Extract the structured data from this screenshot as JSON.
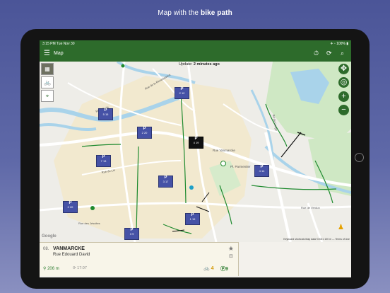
{
  "headline": {
    "prefix": "Map with the ",
    "bold": "bike path"
  },
  "status_bar": {
    "time": "3:15 PM   Tue Nov 30",
    "right": "✈ ◦ 100% ▮"
  },
  "app_bar": {
    "title": "Map",
    "menu_icon": "hamburger-icon",
    "actions": [
      "timer-icon",
      "refresh-icon",
      "search-icon"
    ]
  },
  "map": {
    "update_prefix": "Update: ",
    "update_value": "2 minutes ago",
    "layer_buttons": [
      "satellite-layer-icon",
      "bike-layer-icon",
      "location-pin-icon"
    ],
    "zoom_buttons": [
      "+",
      "◎",
      "+",
      "−"
    ],
    "street_labels": [
      "Rue de la Renaissance",
      "Rue du Lin",
      "Rue Vanmarcke",
      "Pl. Parmentier",
      "Rue de Verdun",
      "Bd du Cange",
      "Rue des Jésuites",
      "River Belle"
    ],
    "attribution": "Keyboard shortcuts   Map data ©2021   100 m ⎯⎯   Terms of Use",
    "google_logo": "Google",
    "stations": [
      {
        "line1": "2",
        "line2": "12",
        "selected": false
      },
      {
        "line1": "5",
        "line2": "15",
        "selected": false
      },
      {
        "line1": "2",
        "line2": "20",
        "selected": false
      },
      {
        "line1": "4",
        "line2": "19",
        "selected": true
      },
      {
        "line1": "7",
        "line2": "13",
        "selected": false
      },
      {
        "line1": "4",
        "line2": "14",
        "selected": false
      },
      {
        "line1": "3",
        "line2": "17",
        "selected": false
      },
      {
        "line1": "0",
        "line2": "20",
        "selected": false
      },
      {
        "line1": "1",
        "line2": "19",
        "selected": false
      },
      {
        "line1": "3",
        "line2": "9",
        "selected": false
      }
    ]
  },
  "station_panel": {
    "number": "08.",
    "name": "VANMARCKE",
    "street": "Rue Edouard David",
    "distance": "206 m",
    "updated": "17:07",
    "bikes": "4",
    "docks": "9"
  }
}
